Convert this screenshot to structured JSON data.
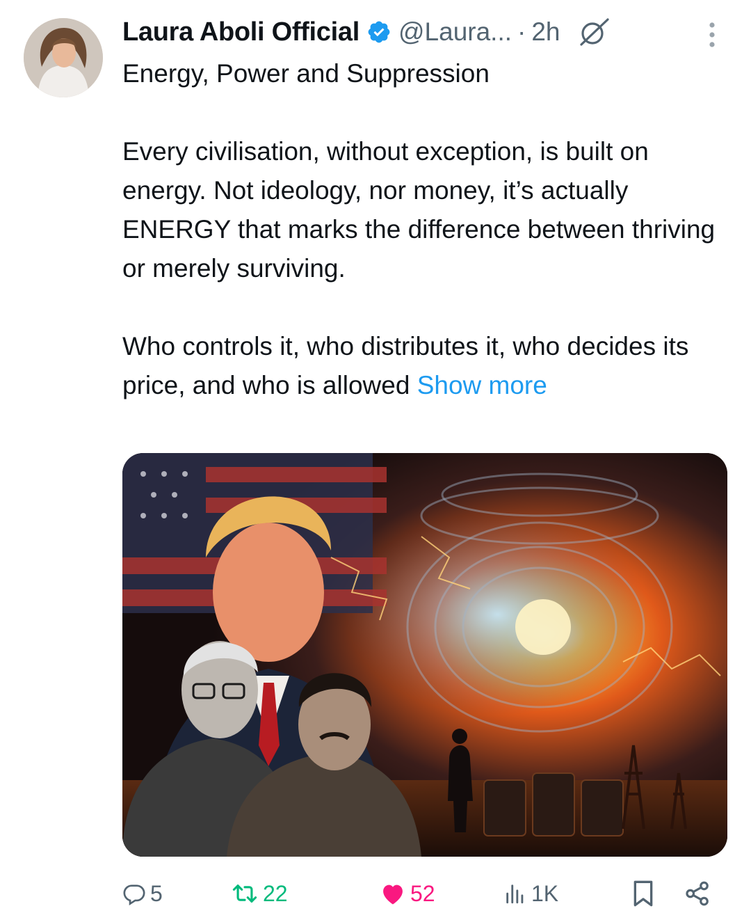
{
  "post": {
    "author_name": "Laura Aboli Official",
    "handle": "@Laura...",
    "separator": "·",
    "time": "2h",
    "paragraphs": [
      "Energy, Power and Suppression",
      "Every civilisation, without exception, is built on energy. Not ideology, nor money, it’s actually ENERGY that marks the difference between thriving or merely surviving.",
      "Who controls it, who distributes it, who decides its price, and who is allowed"
    ],
    "show_more_label": "Show more"
  },
  "actions": {
    "replies": "5",
    "reposts": "22",
    "likes": "52",
    "views": "1K"
  },
  "colors": {
    "accent": "#1d9bf0",
    "repost": "#00ba7c",
    "like": "#f91880",
    "muted": "#536471"
  },
  "icons": [
    "verified-badge-icon",
    "grok-icon",
    "more-options-icon",
    "reply-icon",
    "repost-icon",
    "like-icon",
    "views-icon",
    "bookmark-icon",
    "share-icon"
  ]
}
